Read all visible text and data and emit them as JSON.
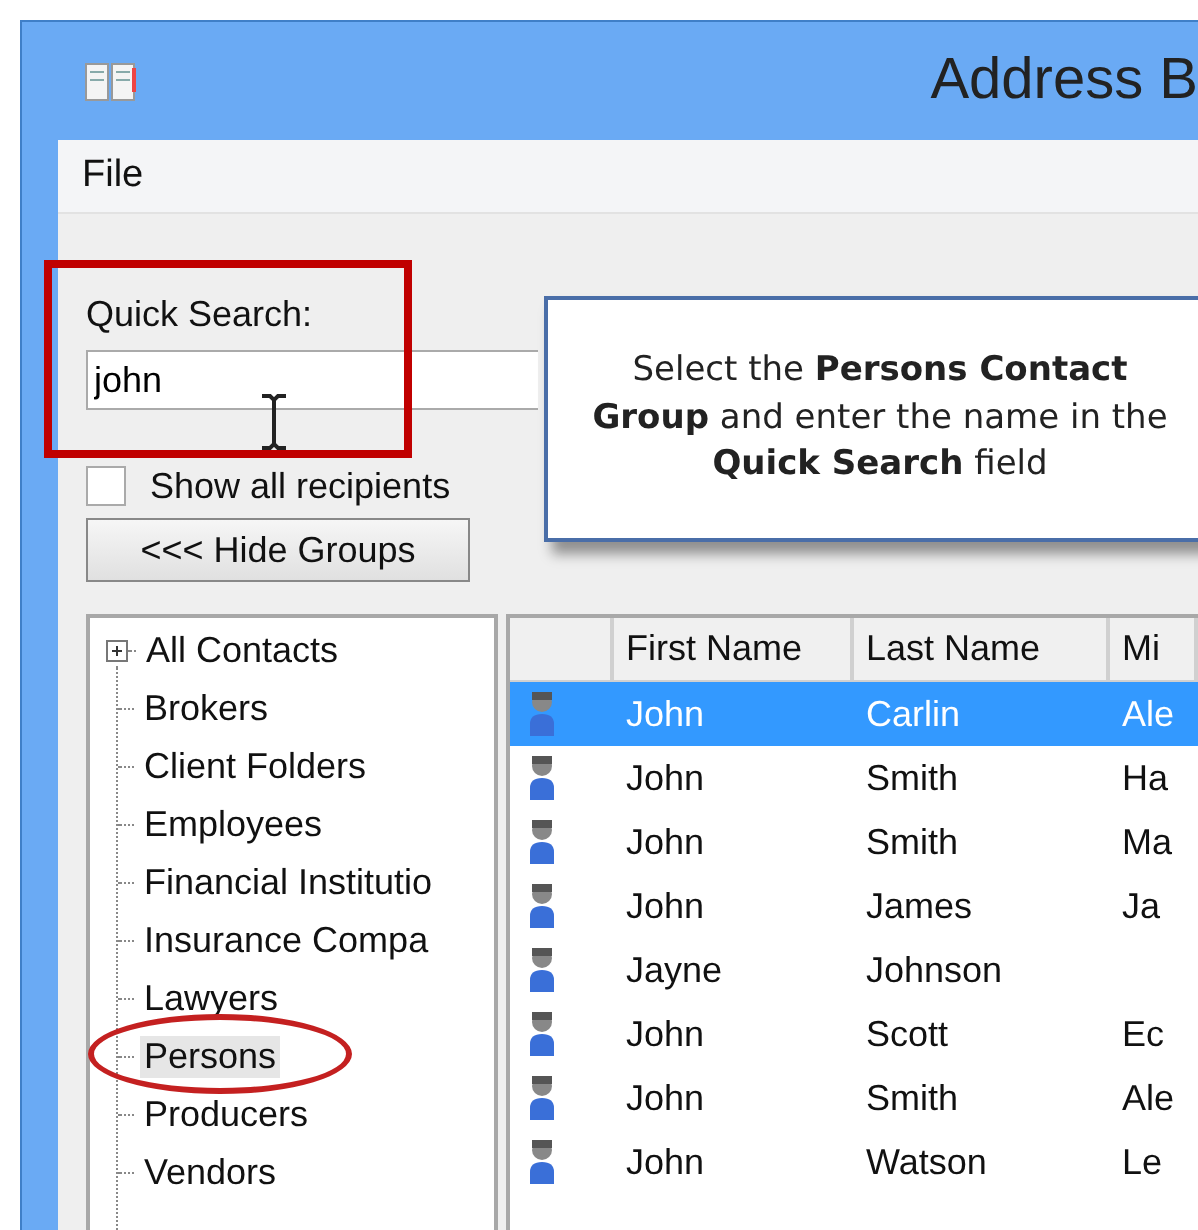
{
  "window": {
    "title": "Address B"
  },
  "menu": [
    {
      "label": "File"
    }
  ],
  "quick_search": {
    "label": "Quick Search:",
    "value": "john"
  },
  "show_all": {
    "label": "Show all recipients",
    "checked": false
  },
  "hide_groups_button": {
    "label": "<<< Hide Groups"
  },
  "callout": {
    "text": "Select the **Persons Contact Group** and enter the name in the **Quick Search** field"
  },
  "groups": [
    {
      "label": "All Contacts",
      "expanded": false,
      "selected": false
    },
    {
      "label": "Brokers",
      "selected": false
    },
    {
      "label": "Client Folders",
      "selected": false
    },
    {
      "label": "Employees",
      "selected": false
    },
    {
      "label": "Financial Institutio",
      "selected": false
    },
    {
      "label": "Insurance Compa",
      "selected": false
    },
    {
      "label": "Lawyers",
      "selected": false
    },
    {
      "label": "Persons",
      "selected": true
    },
    {
      "label": "Producers",
      "selected": false
    },
    {
      "label": "Vendors",
      "selected": false
    }
  ],
  "table": {
    "columns": [
      "First Name",
      "Last Name",
      "Mi"
    ],
    "rows": [
      {
        "first": "John",
        "last": "Carlin",
        "column_3": "Ale",
        "selected": true
      },
      {
        "first": "John",
        "last": "Smith",
        "column_3": "Ha",
        "selected": false
      },
      {
        "first": "John",
        "last": "Smith",
        "column_3": "Ma",
        "selected": false
      },
      {
        "first": "John",
        "last": "James",
        "column_3": "Ja",
        "selected": false
      },
      {
        "first": "Jayne",
        "last": "Johnson",
        "selected": false
      },
      {
        "first": "John",
        "last": "Scott",
        "column_3": "Ec",
        "selected": false
      },
      {
        "first": "John",
        "last": "Smith",
        "column_3": "Ale",
        "selected": false
      },
      {
        "first": "John",
        "last": "Watson",
        "column_3": "Le",
        "selected": false
      }
    ]
  }
}
